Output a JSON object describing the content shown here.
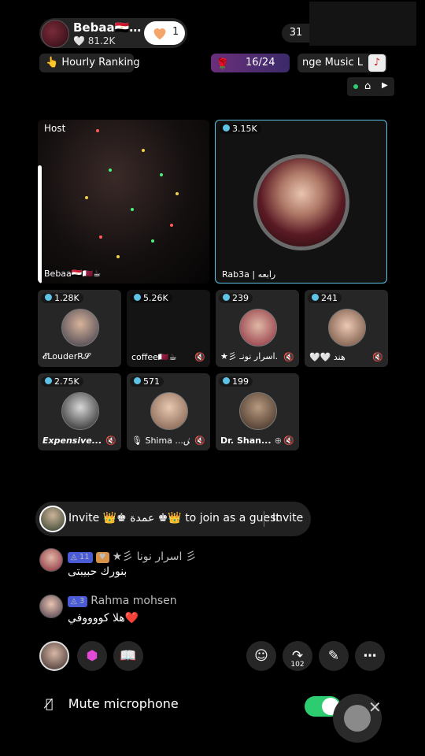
{
  "host": {
    "name": "Bebaa🇪🇬…",
    "likes": "🤍 81.2K",
    "follow_count": "1",
    "viewers": "31"
  },
  "top": {
    "ranking": "👆 Hourly Ranking",
    "progress": "16/24",
    "music": "nge   Music L"
  },
  "host_tile": {
    "label": "Host",
    "name": "Bebaa🇪🇬🇶🇦☕"
  },
  "guest_big": {
    "points": "3.15K",
    "name": "Rab3a | رابعه"
  },
  "seats": [
    {
      "points": "1.28K",
      "name": "𝓔LouderR𝓢"
    },
    {
      "points": "5.26K",
      "name": "coffee🇶🇦☕"
    },
    {
      "points": "239",
      "name": "★彡 اسرار نونـ..."
    },
    {
      "points": "241",
      "name": "🤍🤍 هند"
    },
    {
      "points": "2.75K",
      "name": "Expensive..."
    },
    {
      "points": "571",
      "name": "🎙 Shima ...ش"
    },
    {
      "points": "199",
      "name": "Dr. Shan..."
    }
  ],
  "invite": {
    "text": "Invite 👑♚ عمدة ♚👑 to join as a guest",
    "button": "Invite"
  },
  "comments": [
    {
      "level": "11",
      "name": "★彡 اسرار نونا 彡",
      "msg": "بنورك حبيبتى"
    },
    {
      "level": "3",
      "name": "Rahma mohsen",
      "msg": "هلا كووووفي❤️"
    }
  ],
  "toolbar": {
    "share_count": "102"
  },
  "mute": {
    "label": "Mute microphone",
    "on": true
  },
  "colors": {
    "accent": "#5ec3e6",
    "toggle": "#2ecc71",
    "badge": "#4a5bd6"
  }
}
